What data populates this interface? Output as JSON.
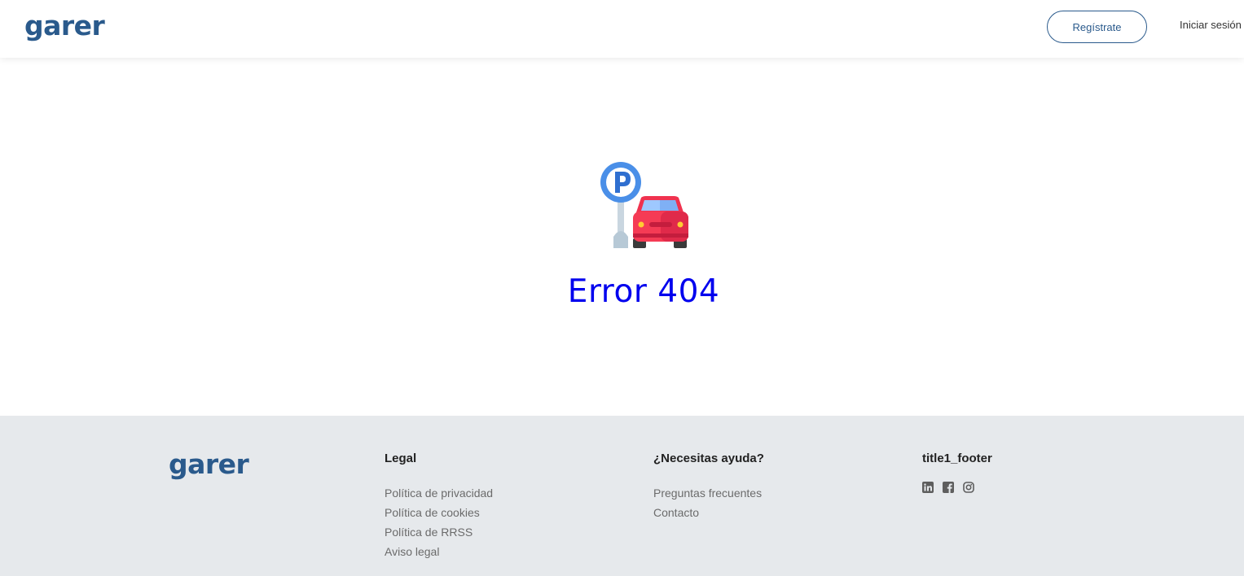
{
  "header": {
    "logo": "garer",
    "register_label": "Regístrate",
    "login_label": "Iniciar sesión"
  },
  "main": {
    "error_title": "Error 404",
    "illustration_icon": "parking-sign-and-car-icon"
  },
  "footer": {
    "logo": "garer",
    "legal": {
      "title": "Legal",
      "links": [
        "Política de privacidad",
        "Política de cookies",
        "Política de RRSS",
        "Aviso legal"
      ]
    },
    "help": {
      "title": "¿Necesitas ayuda?",
      "links": [
        "Preguntas frecuentes",
        "Contacto"
      ]
    },
    "social": {
      "title": "title1_footer",
      "icons": [
        "linkedin-icon",
        "facebook-icon",
        "instagram-icon"
      ]
    }
  },
  "colors": {
    "brand": "#2a5a8c",
    "error_text": "#0000ee",
    "footer_bg": "#e6e9ec"
  }
}
